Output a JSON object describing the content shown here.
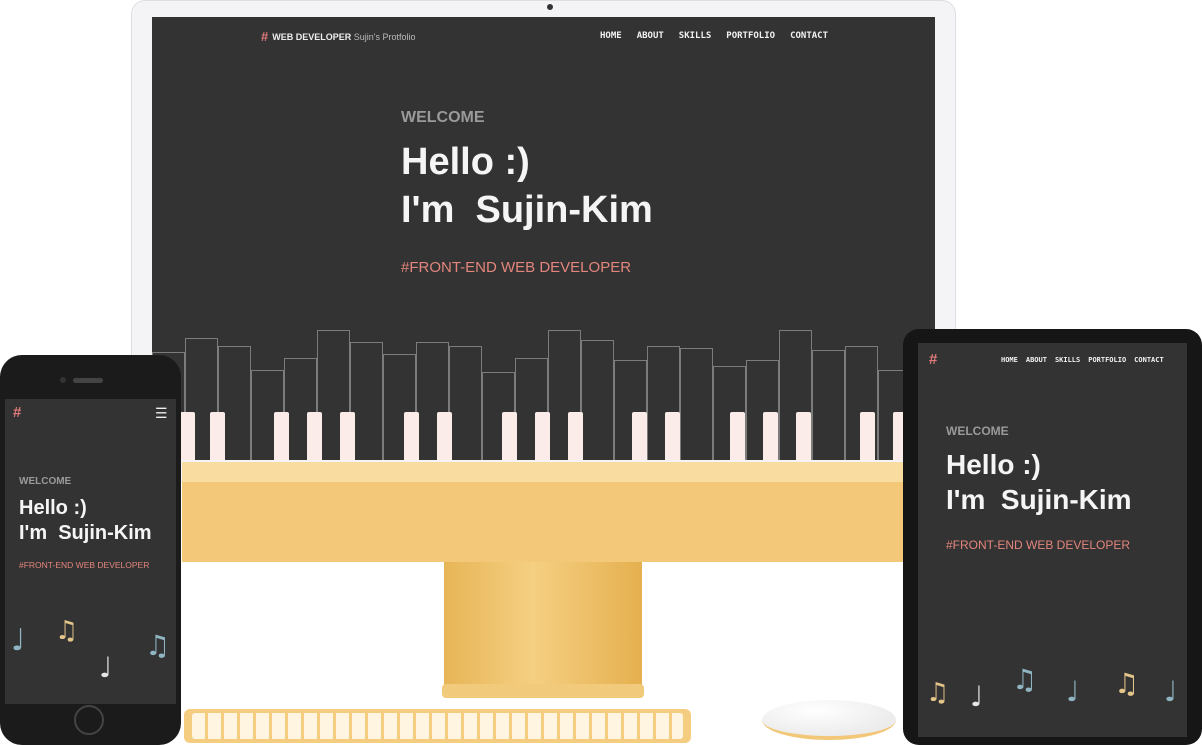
{
  "site": {
    "logo": "#",
    "brand_title": "WEB DEVELOPER",
    "brand_subtitle": "Sujin's Protfolio",
    "nav": [
      "HOME",
      "ABOUT",
      "SKILLS",
      "PORTFOLIO",
      "CONTACT"
    ],
    "welcome": "WELCOME",
    "hello_line1": "Hello :)",
    "hello_line2": "I'm  Sujin-Kim",
    "tagline": "#FRONT-END WEB DEVELOPER",
    "menu_icon": "hamburger-icon"
  },
  "colors": {
    "background": "#333333",
    "accent": "#e3857c",
    "text": "#f5f5f5",
    "muted": "#9a9a9a",
    "gold": "#f3c879"
  },
  "music_notes": {
    "phone": [
      "♩",
      "♫",
      "♩",
      "♫"
    ],
    "tablet": [
      "♫",
      "♩",
      "♫",
      "♩",
      "♫",
      "♩"
    ]
  }
}
